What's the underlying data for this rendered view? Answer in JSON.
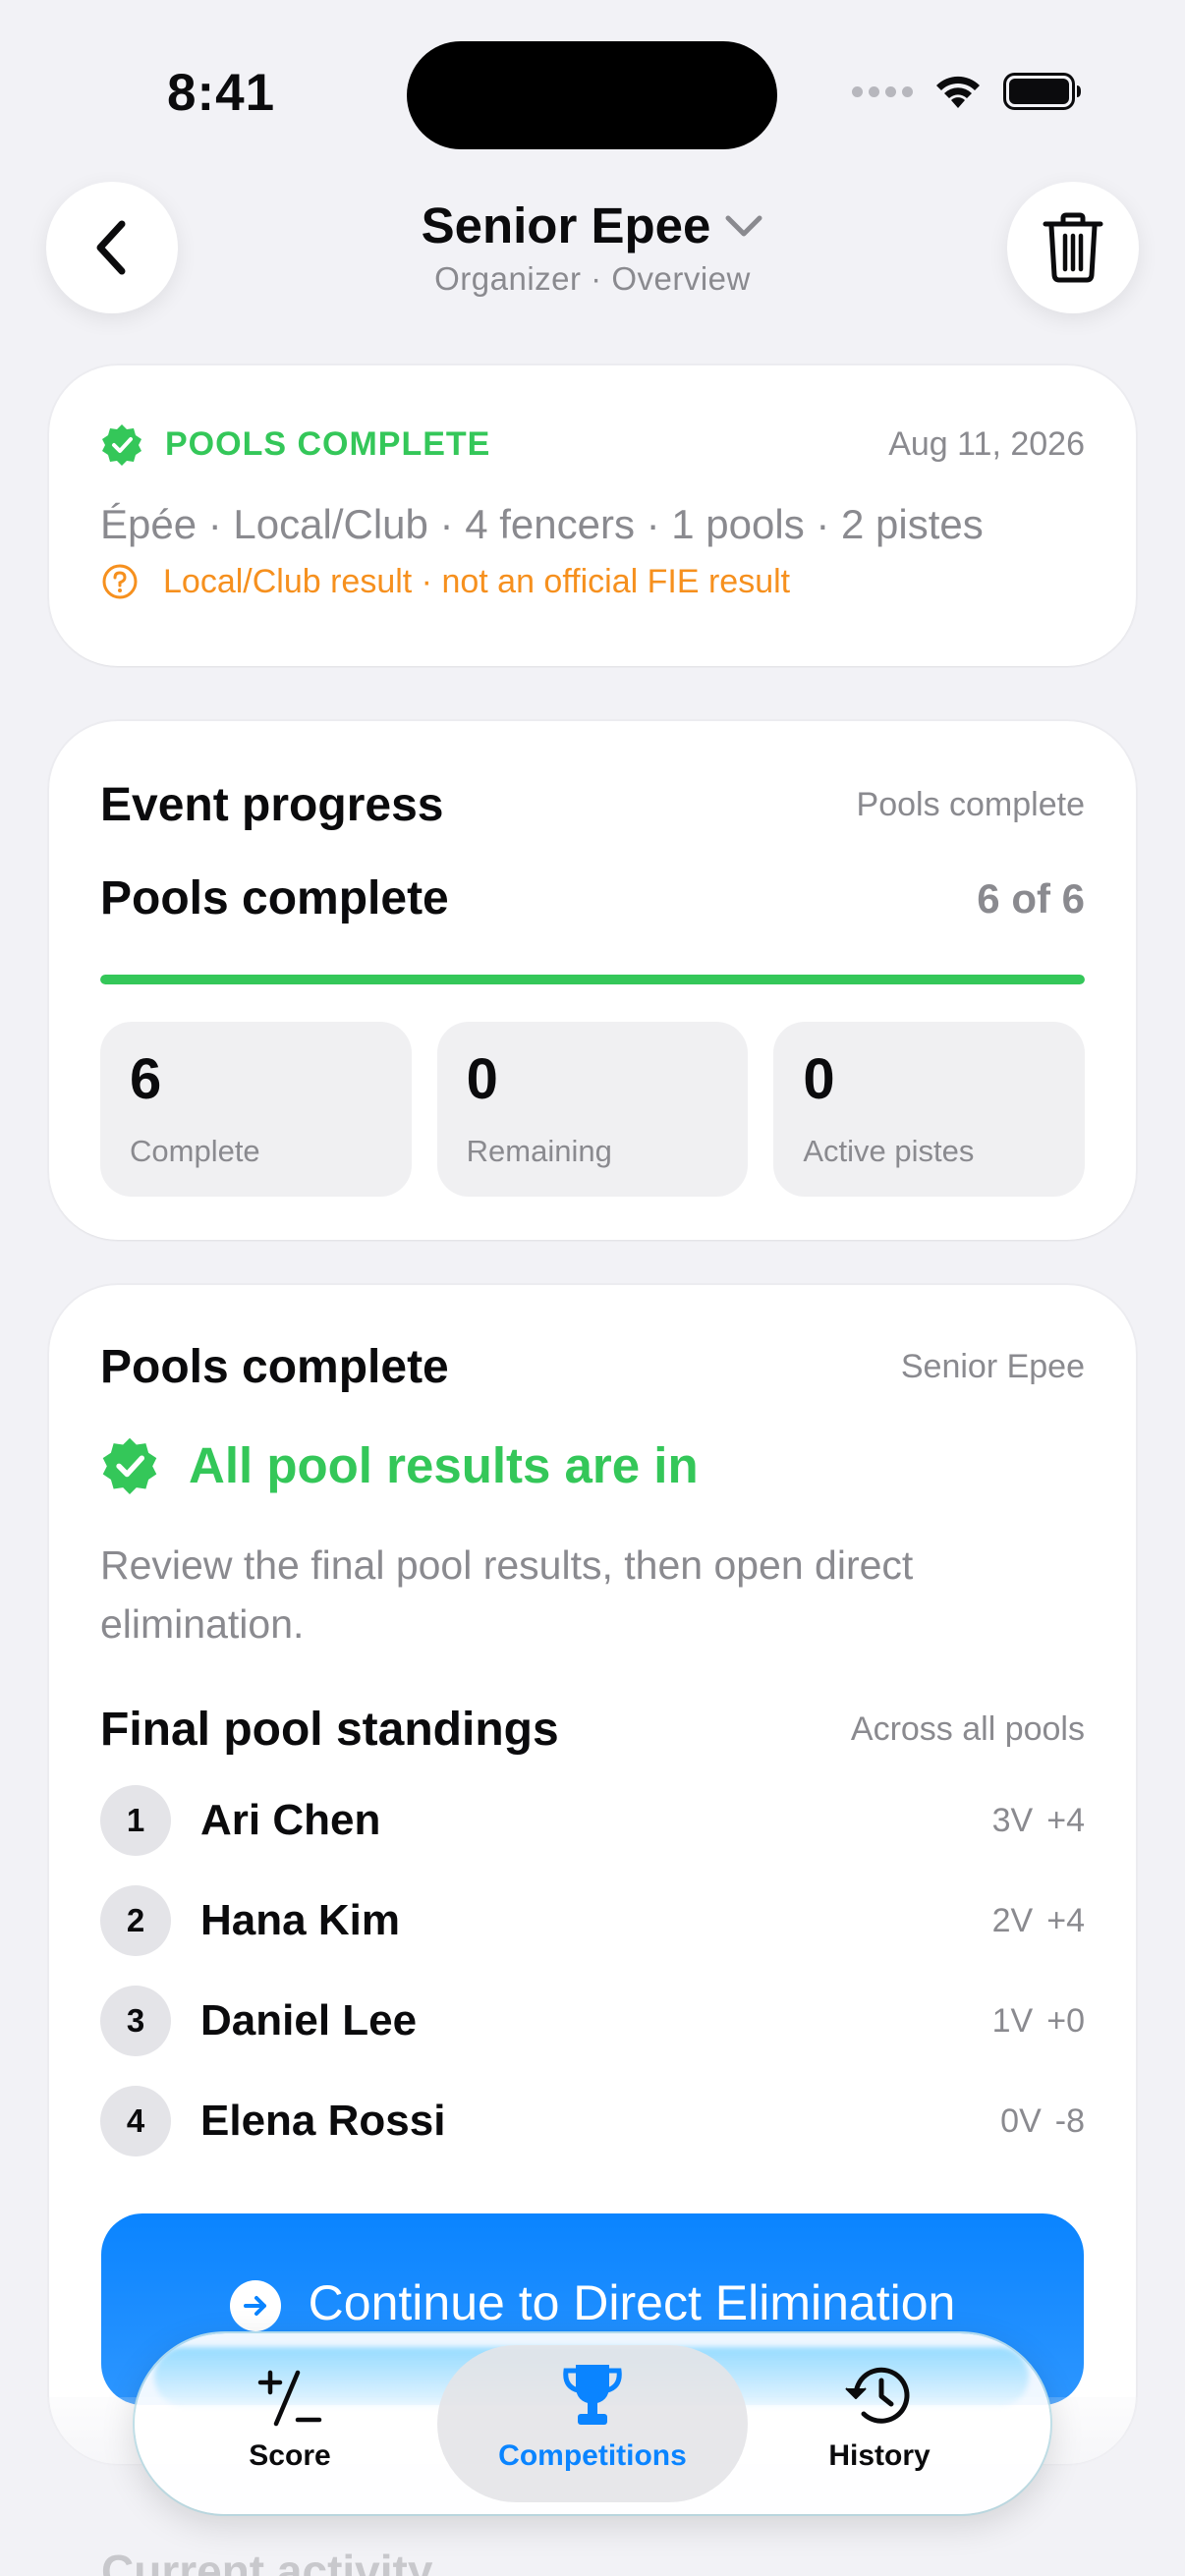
{
  "status_bar": {
    "time": "8:41"
  },
  "header": {
    "title": "Senior Epee",
    "subtitle": "Organizer · Overview"
  },
  "summary_card": {
    "status": "POOLS COMPLETE",
    "date": "Aug 11, 2026",
    "meta": "Épée · Local/Club · 4 fencers · 1 pools · 2 pistes",
    "warning": "Local/Club result · not an official FIE result",
    "status_color": "#34c759",
    "warning_color": "#f6901e"
  },
  "progress_card": {
    "title": "Event progress",
    "aside": "Pools complete",
    "phase": "Pools complete",
    "count": "6 of 6",
    "progress_fraction": 1.0,
    "stats": [
      {
        "value": "6",
        "label": "Complete"
      },
      {
        "value": "0",
        "label": "Remaining"
      },
      {
        "value": "0",
        "label": "Active pistes"
      }
    ]
  },
  "pools_card": {
    "title": "Pools complete",
    "aside": "Senior Epee",
    "headline": "All pool results are in",
    "description": "Review the final pool results, then open direct elimination.",
    "standings_title": "Final pool standings",
    "standings_aside": "Across all pools",
    "standings": [
      {
        "rank": "1",
        "name": "Ari Chen",
        "victories": "3V",
        "indicator": "+4"
      },
      {
        "rank": "2",
        "name": "Hana Kim",
        "victories": "2V",
        "indicator": "+4"
      },
      {
        "rank": "3",
        "name": "Daniel Lee",
        "victories": "1V",
        "indicator": "+0"
      },
      {
        "rank": "4",
        "name": "Elena Rossi",
        "victories": "0V",
        "indicator": "-8"
      }
    ],
    "cta_label": "Continue to Direct Elimination"
  },
  "next_section_title": "Current activity",
  "tabbar": {
    "tabs": [
      {
        "label": "Score",
        "icon": "plus-minus-icon"
      },
      {
        "label": "Competitions",
        "icon": "trophy-icon",
        "selected": true
      },
      {
        "label": "History",
        "icon": "history-clock-icon"
      }
    ],
    "accent": "#0a84ff"
  }
}
